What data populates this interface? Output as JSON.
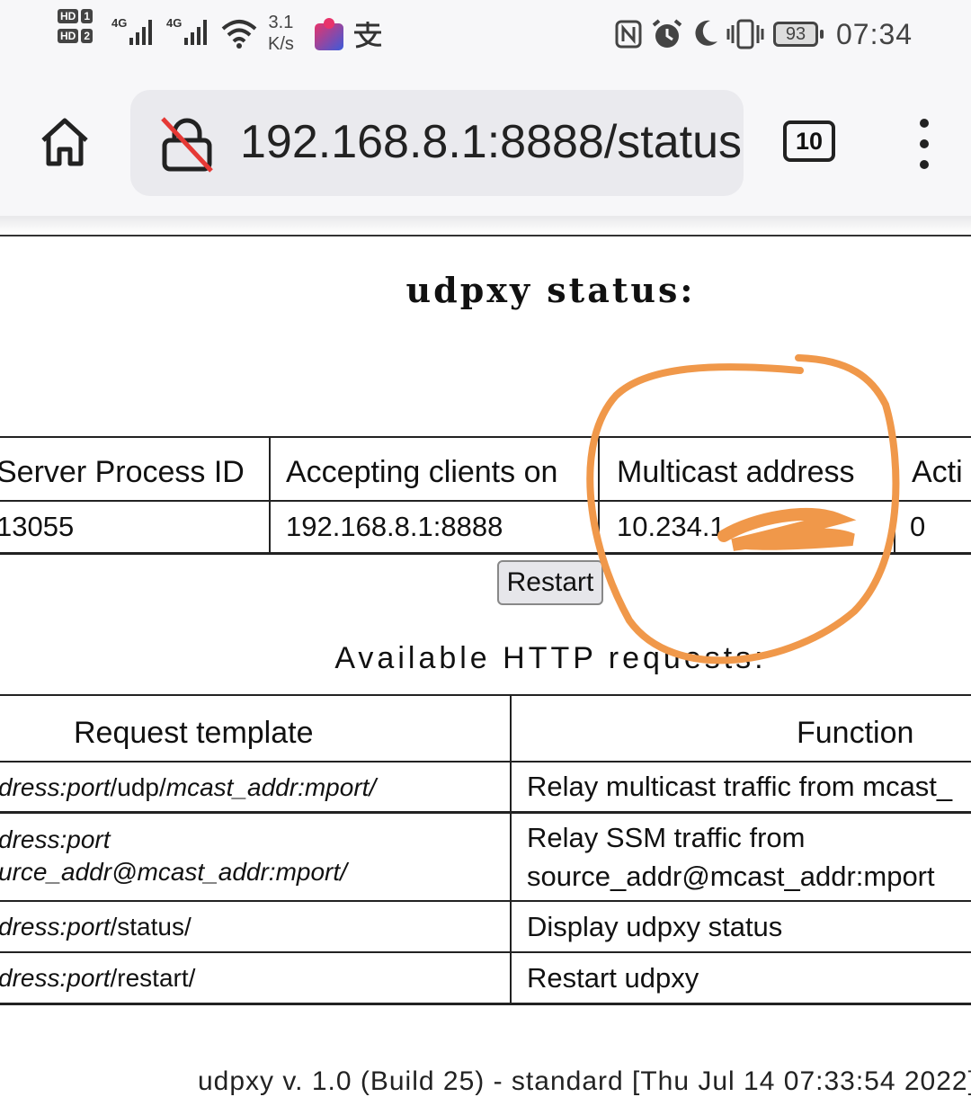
{
  "status_bar": {
    "sim1_label": "HD",
    "sim1_num": "1",
    "sim2_label": "HD",
    "sim2_num": "2",
    "net1": "4G",
    "net2": "4G",
    "speed_value": "3.1",
    "speed_unit": "K/s",
    "time": "07:34",
    "battery": "93",
    "icons": [
      "signal-icon",
      "wifi-icon",
      "puzzle-app-icon",
      "alipay-icon",
      "nfc-icon",
      "alarm-icon",
      "moon-icon",
      "vibrate-icon",
      "battery-icon"
    ],
    "colors": {
      "puzzle_pink": "#e8336b",
      "puzzle_blue": "#3b5bdb"
    }
  },
  "browser": {
    "url": "192.168.8.1:8888/status",
    "tab_count": "10",
    "icons": [
      "home-icon",
      "insecure-lock-icon",
      "more-vert-icon"
    ]
  },
  "page": {
    "title": "udpxy status:",
    "status_table": {
      "headers": [
        "Server Process ID",
        "Accepting clients on",
        "Multicast address",
        "Acti"
      ],
      "row": [
        "13055",
        "192.168.8.1:8888",
        "10.234.1",
        "0"
      ]
    },
    "restart_label": "Restart",
    "http_title": "Available HTTP requests:",
    "requests_table": {
      "headers": [
        "Request template",
        "Function"
      ],
      "rows": [
        {
          "tpl_a": "dress:port",
          "tpl_b": "/udp/",
          "tpl_c": "mcast_addr:mport/",
          "fn1": "Relay multicast traffic from mcast_",
          "fn2": ""
        },
        {
          "tpl_a": "dress:port",
          "tpl_b": "urce_addr@mcast_addr:mport/",
          "tpl_c": "",
          "fn1": "Relay SSM traffic from",
          "fn2": "source_addr@mcast_addr:mport"
        },
        {
          "tpl_a": "dress:port",
          "tpl_b": "/status/",
          "tpl_c": "",
          "fn1": "Display udpxy status",
          "fn2": ""
        },
        {
          "tpl_a": "dress:port",
          "tpl_b": "/restart/",
          "tpl_c": "",
          "fn1": "Restart udpxy",
          "fn2": ""
        }
      ]
    },
    "footer": "udpxy v. 1.0 (Build 25) - standard [Thu Jul 14 07:33:54 2022]"
  },
  "annotation": {
    "color": "#f0984a"
  }
}
